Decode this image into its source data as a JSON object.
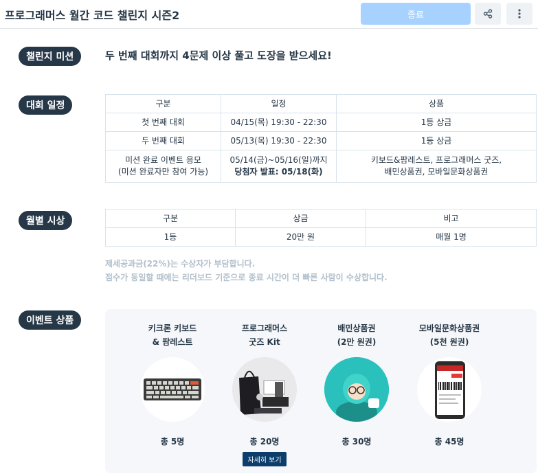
{
  "header": {
    "title": "프로그래머스 월간 코드 챌린지 시즌2",
    "end_label": "종료"
  },
  "sections": {
    "mission": "챌린지 미션",
    "schedule": "대회 일정",
    "monthly": "월별 시상",
    "event": "이벤트 상품"
  },
  "mission_text": "두 번째 대회까지 4문제 이상 풀고 도장을 받으세요!",
  "schedule_table": {
    "headers": [
      "구분",
      "일정",
      "상품"
    ],
    "rows": [
      {
        "type": "첫 번째 대회",
        "date": "04/15(목) 19:30 - 22:30",
        "prize": "1등 상금"
      },
      {
        "type": "두 번째 대회",
        "date": "05/13(목) 19:30 - 22:30",
        "prize": "1등 상금"
      },
      {
        "type_line1": "미션 완료 이벤트 응모",
        "type_line2": "(미션 완료자만 참여 가능)",
        "date_line1": "05/14(금)~05/16(일)까지",
        "date_line2": "당첨자 발표: 05/18(화)",
        "prize_line1": "키보드&팜레스트, 프로그래머스 굿즈,",
        "prize_line2": "배민상품권, 모바일문화상품권"
      }
    ]
  },
  "monthly_table": {
    "headers": [
      "구분",
      "상금",
      "비고"
    ],
    "rows": [
      {
        "rank": "1등",
        "amount": "20만 원",
        "note": "매월 1명"
      }
    ]
  },
  "notes": [
    "제세공과금(22%)는 수상자가 부담합니다.",
    "점수가 동일할 때에는 리더보드 기준으로 종료 시간이 더 빠른 사람이 수상합니다."
  ],
  "prizes": [
    {
      "name_line1": "키크론 키보드",
      "name_line2": "& 팜레스트",
      "count": "총 5명",
      "icon": "keyboard-image"
    },
    {
      "name_line1": "프로그래머스",
      "name_line2": "굿즈 Kit",
      "count": "총 20명",
      "detail": "자세히 보기",
      "icon": "goods-kit-image"
    },
    {
      "name_line1": "배민상품권",
      "name_line2": "(2만 원권)",
      "count": "총 30명",
      "icon": "baemin-image"
    },
    {
      "name_line1": "모바일문화상품권",
      "name_line2": "(5천 원권)",
      "count": "총 45명",
      "icon": "mobile-gift-image"
    }
  ],
  "colors": {
    "label_bg": "#263747",
    "end_button": "#a7d2ff",
    "note_text": "#b2c0cc",
    "detail_button": "#0c3d6b"
  }
}
